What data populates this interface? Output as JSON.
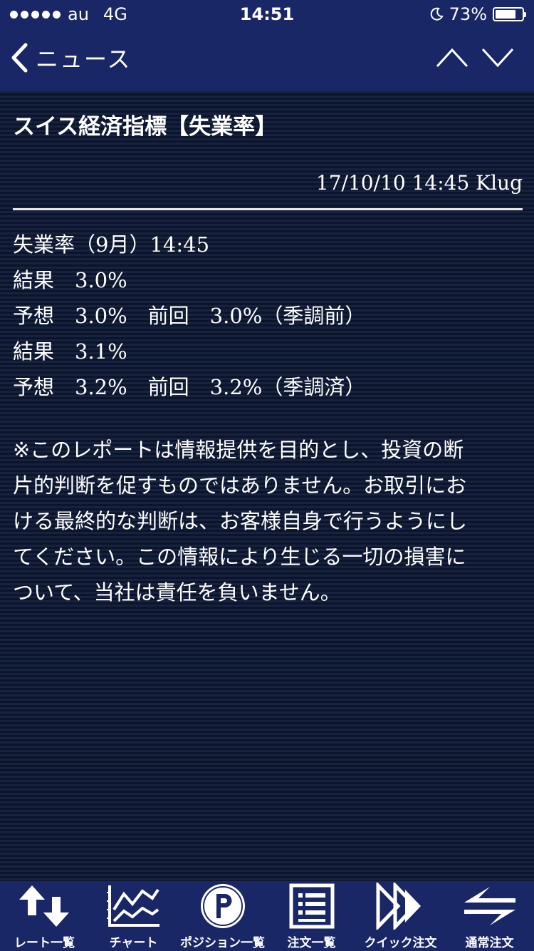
{
  "status_bar": {
    "carrier": "au",
    "network": "4G",
    "time": "14:51",
    "battery": "73%"
  },
  "nav": {
    "back_label": "ニュース"
  },
  "article": {
    "title": "スイス経済指標【失業率】",
    "meta": "17/10/10 14:45 Klug",
    "lines": [
      "失業率（9月）14:45",
      "結果　3.0%",
      "予想　3.0%　前回　3.0%（季調前）",
      "結果　3.1%",
      "予想　3.2%　前回　3.2%（季調済）"
    ],
    "disclaimer_lines": [
      "※このレポートは情報提供を目的とし、投資の断",
      "片的判断を促すものではありません。お取引にお",
      "ける最終的な判断は、お客様自身で行うようにし",
      "てください。この情報により生じる一切の損害に",
      "ついて、当社は責任を負いません。"
    ]
  },
  "tabs": [
    {
      "label": "レート一覧",
      "icon": "rate-list-icon"
    },
    {
      "label": "チャート",
      "icon": "chart-icon"
    },
    {
      "label": "ポジション一覧",
      "icon": "position-icon"
    },
    {
      "label": "注文一覧",
      "icon": "order-list-icon"
    },
    {
      "label": "クイック注文",
      "icon": "quick-order-icon"
    },
    {
      "label": "通常注文",
      "icon": "normal-order-icon"
    }
  ],
  "colors": {
    "header_bg": "#1a2766",
    "content_bg": "#0f1a33",
    "text": "#ffffff"
  }
}
